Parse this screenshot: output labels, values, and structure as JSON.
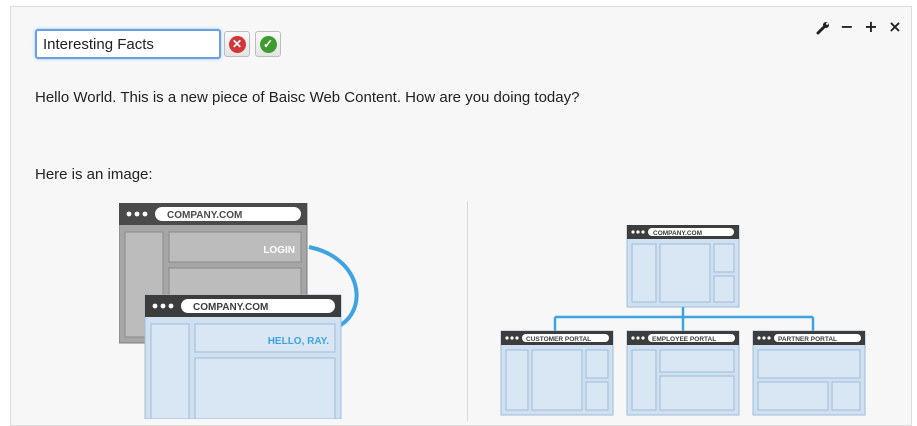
{
  "portlet": {
    "title_value": "Interesting Facts",
    "cancel_icon": "x-circle-icon",
    "save_icon": "check-circle-icon",
    "window_controls": {
      "configure_icon": "wrench-icon",
      "minimize_label": "−",
      "maximize_label": "+",
      "close_label": "×"
    }
  },
  "content": {
    "paragraph": "Hello World. This is a new piece of Baisc Web Content. How are you doing today?",
    "image_caption": "Here is an image:"
  },
  "illustration": {
    "left": {
      "back_window_url": "COMPANY.COM",
      "back_window_link": "LOGIN",
      "front_window_url": "COMPANY.COM",
      "front_window_greeting": "HELLO, RAY."
    },
    "right": {
      "top_window_url": "COMPANY.COM",
      "portals": [
        "CUSTOMER PORTAL",
        "EMPLOYEE PORTAL",
        "PARTNER PORTAL"
      ]
    }
  },
  "colors": {
    "accent_blue": "#3ea3e0",
    "panel_light_blue": "#cfe0f0",
    "panel_border_blue": "#9fbcd9",
    "grey_window": "#9a9a9a",
    "dark_bar": "#444444"
  }
}
